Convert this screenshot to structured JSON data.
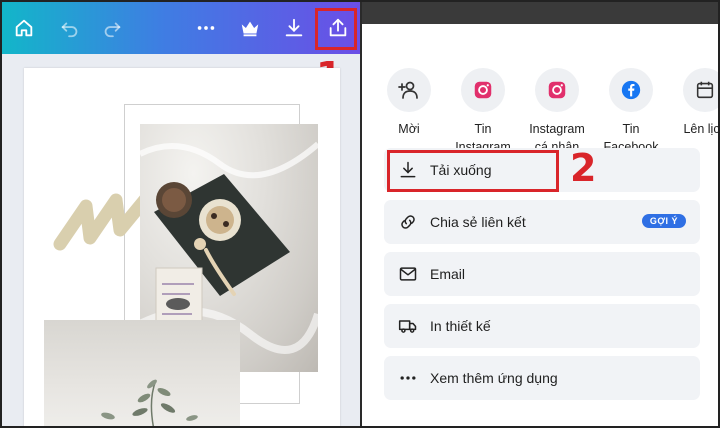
{
  "editor": {
    "toolbar_icons": [
      "home-icon",
      "undo-icon",
      "redo-icon",
      "more-icon",
      "crown-icon",
      "download-icon",
      "share-icon"
    ],
    "step_1": "1"
  },
  "share_menu": {
    "targets": [
      {
        "label": "Mời",
        "icon": "add-people-icon"
      },
      {
        "label": "Tin\nInstagram",
        "icon": "instagram-icon"
      },
      {
        "label": "Instagram\ncá nhân",
        "icon": "instagram-icon"
      },
      {
        "label": "Tin\nFacebook",
        "icon": "facebook-icon"
      },
      {
        "label": "Lên lịch",
        "icon": "calendar-icon"
      }
    ],
    "actions": [
      {
        "label": "Tải xuống",
        "icon": "download-icon"
      },
      {
        "label": "Chia sẻ liên kết",
        "icon": "link-icon",
        "badge": "GỢI Ý"
      },
      {
        "label": "Email",
        "icon": "email-icon"
      },
      {
        "label": "In thiết kế",
        "icon": "truck-icon"
      },
      {
        "label": "Xem thêm ứng dụng",
        "icon": "more-icon"
      }
    ],
    "step_2": "2"
  },
  "colors": {
    "highlight": "#d9252a",
    "badge": "#2f6fe4",
    "instagram": "#e1306c",
    "facebook": "#1877f2"
  }
}
